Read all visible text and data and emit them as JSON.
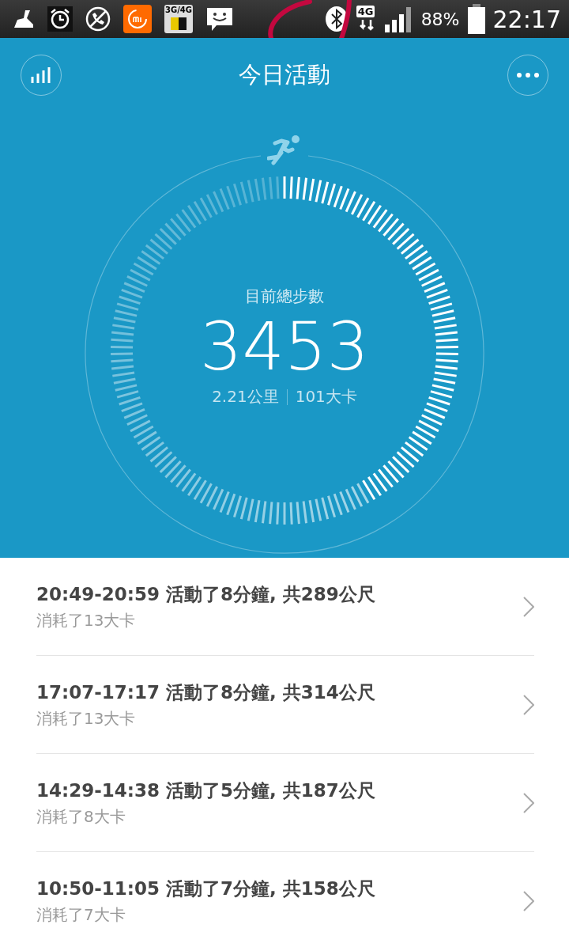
{
  "status_bar": {
    "sim_label": "3G/4G",
    "network_label": "4G",
    "battery": "88%",
    "time": "22:17"
  },
  "header": {
    "title": "今日活動"
  },
  "ring": {
    "label": "目前總步數",
    "steps": "3453",
    "distance": "2.21公里",
    "calories": "101大卡"
  },
  "activities": [
    {
      "title": "20:49-20:59 活動了8分鐘, 共289公尺",
      "subtitle": "消耗了13大卡"
    },
    {
      "title": "17:07-17:17 活動了8分鐘, 共314公尺",
      "subtitle": "消耗了13大卡"
    },
    {
      "title": "14:29-14:38 活動了5分鐘, 共187公尺",
      "subtitle": "消耗了8大卡"
    },
    {
      "title": "10:50-11:05 活動了7分鐘, 共158公尺",
      "subtitle": "消耗了7大卡"
    }
  ]
}
